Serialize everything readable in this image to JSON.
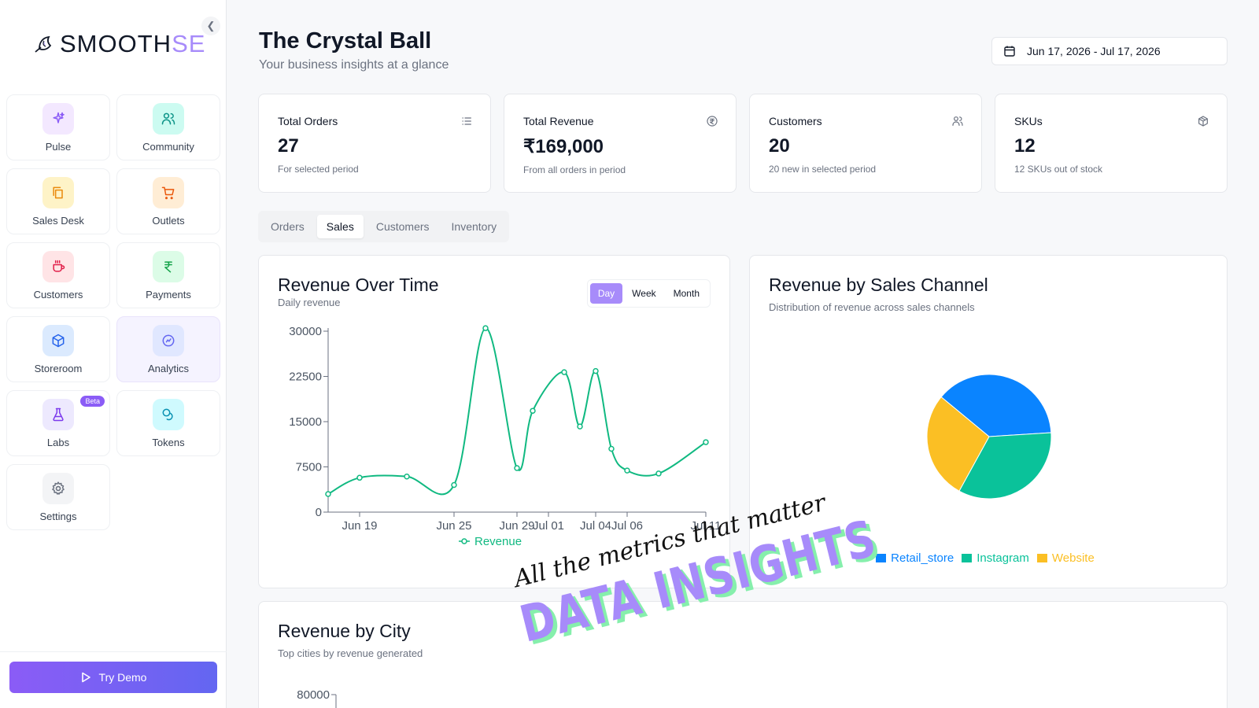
{
  "app": {
    "brand_prefix": "SMOOTH",
    "brand_accent": "SE",
    "accent_color": "#a78bfa"
  },
  "sidebar": {
    "items": [
      {
        "label": "Pulse",
        "icon": "sparkles-icon",
        "color": "#8b5cf6",
        "bg": "#f3e8ff"
      },
      {
        "label": "Community",
        "icon": "users-icon",
        "color": "#0d9488",
        "bg": "#ccfbf1"
      },
      {
        "label": "Sales Desk",
        "icon": "copy-icon",
        "color": "#ea8a0c",
        "bg": "#fef3c7"
      },
      {
        "label": "Outlets",
        "icon": "cart-icon",
        "color": "#ea580c",
        "bg": "#ffedd5"
      },
      {
        "label": "Customers",
        "icon": "cup-icon",
        "color": "#e11d48",
        "bg": "#ffe4e6"
      },
      {
        "label": "Payments",
        "icon": "rupee-icon",
        "color": "#16a34a",
        "bg": "#dcfce7"
      },
      {
        "label": "Storeroom",
        "icon": "box-icon",
        "color": "#2563eb",
        "bg": "#dbeafe"
      },
      {
        "label": "Analytics",
        "icon": "chart-icon",
        "color": "#6366f1",
        "bg": "#e0e7ff"
      },
      {
        "label": "Labs",
        "icon": "flask-icon",
        "color": "#7c3aed",
        "bg": "#ede9fe",
        "badge": "Beta"
      },
      {
        "label": "Tokens",
        "icon": "coins-icon",
        "color": "#0891b2",
        "bg": "#cffafe"
      },
      {
        "label": "Settings",
        "icon": "gear-icon",
        "color": "#6b7280",
        "bg": "#f3f4f6"
      }
    ],
    "active": "Analytics",
    "try_demo_label": "Try Demo"
  },
  "header": {
    "title": "The Crystal Ball",
    "subtitle": "Your business insights at a glance",
    "date_range": "Jun 17, 2026 - Jul 17, 2026"
  },
  "stats": [
    {
      "title": "Total Orders",
      "value": "27",
      "sub": "For selected period",
      "icon": "list-icon"
    },
    {
      "title": "Total Revenue",
      "value": "₹169,000",
      "sub": "From all orders in period",
      "icon": "rupee-circle-icon"
    },
    {
      "title": "Customers",
      "value": "20",
      "sub": "20 new in selected period",
      "icon": "users-icon"
    },
    {
      "title": "SKUs",
      "value": "12",
      "sub": "12 SKUs out of stock",
      "icon": "package-icon"
    }
  ],
  "tabs": [
    "Orders",
    "Sales",
    "Customers",
    "Inventory"
  ],
  "active_tab": "Sales",
  "revenue_over_time": {
    "title": "Revenue Over Time",
    "subtitle": "Daily revenue",
    "granularity": [
      "Day",
      "Week",
      "Month"
    ],
    "active_granularity": "Day"
  },
  "revenue_by_channel": {
    "title": "Revenue by Sales Channel",
    "subtitle": "Distribution of revenue across sales channels"
  },
  "revenue_by_city": {
    "title": "Revenue by City",
    "subtitle": "Top cities by revenue generated"
  },
  "overlay": {
    "script_text": "All the metrics that matter",
    "big_text": "DATA INSIGHTS"
  },
  "chart_data": [
    {
      "type": "line",
      "x": [
        "Jun 17",
        "Jun 19",
        "Jun 22",
        "Jun 25",
        "Jun 27",
        "Jun 29",
        "Jun 30",
        "Jul 02",
        "Jul 03",
        "Jul 04",
        "Jul 05",
        "Jul 06",
        "Jul 08",
        "Jul 11"
      ],
      "xticks": [
        "Jun 19",
        "Jun 25",
        "Jun 29",
        "Jul 01",
        "Jul 04",
        "Jul 06",
        "Jul 11"
      ],
      "series": [
        {
          "name": "Revenue",
          "values": [
            3000,
            5700,
            5900,
            4500,
            30500,
            7300,
            16800,
            23200,
            14200,
            23400,
            10500,
            6900,
            6400,
            11600
          ],
          "color": "#10b981"
        }
      ],
      "ylim": [
        0,
        30000
      ],
      "yticks": [
        0,
        7500,
        15000,
        22500,
        30000
      ],
      "grid": false,
      "legend": "bottom"
    },
    {
      "type": "pie",
      "labels": [
        "Retail_store",
        "Instagram",
        "Website"
      ],
      "values": [
        38,
        34,
        28
      ],
      "colors": [
        "#0a84ff",
        "#0ac29a",
        "#fbbf24"
      ],
      "legend": "bottom"
    },
    {
      "type": "bar",
      "yticks": [
        80000
      ]
    }
  ]
}
